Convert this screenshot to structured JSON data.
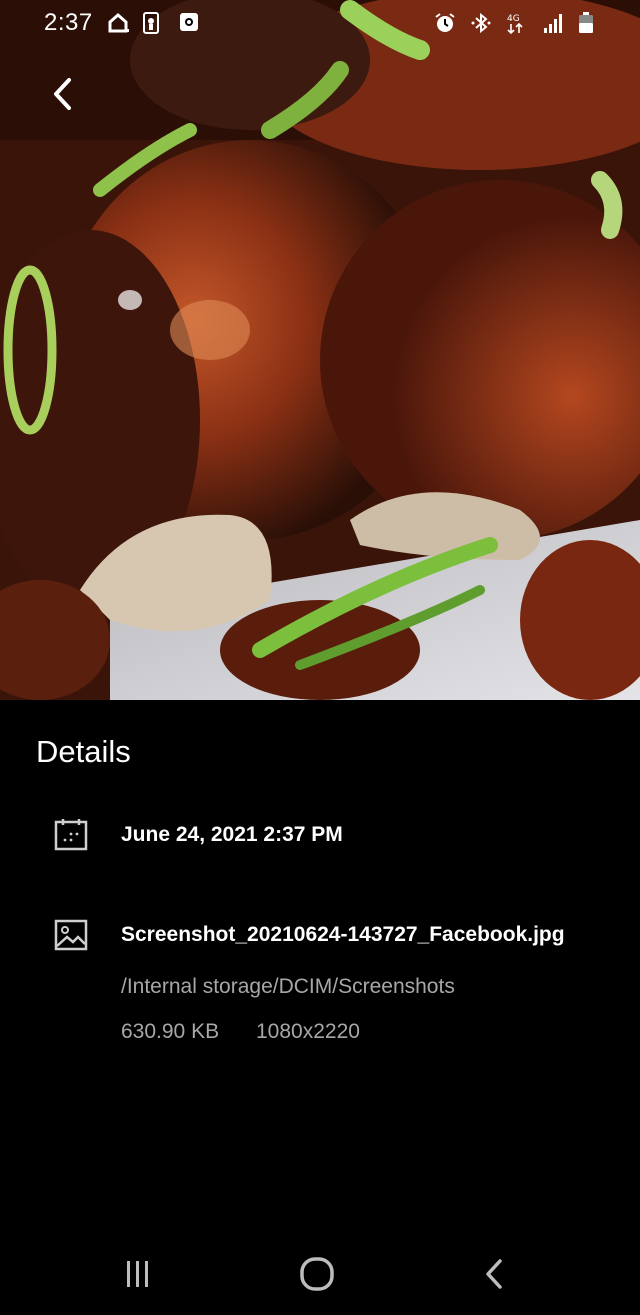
{
  "status_bar": {
    "time": "2:37",
    "left_icons": [
      "home-icon",
      "nba-app-icon",
      "camera-app-icon"
    ],
    "right_icons": [
      "alarm-icon",
      "bluetooth-icon",
      "data-transfer-icon",
      "signal-icon",
      "battery-icon"
    ]
  },
  "photo": {
    "description_icon": "photo-preview"
  },
  "details": {
    "title": "Details",
    "date_time": "June 24, 2021 2:37 PM",
    "file_name": "Screenshot_20210624-143727_Facebook.jpg",
    "path": "/Internal storage/DCIM/Screenshots",
    "size": "630.90 KB",
    "resolution": "1080x2220"
  },
  "nav": {
    "recents": "recents-icon",
    "home": "home-circle-icon",
    "back": "back-chevron-icon"
  }
}
